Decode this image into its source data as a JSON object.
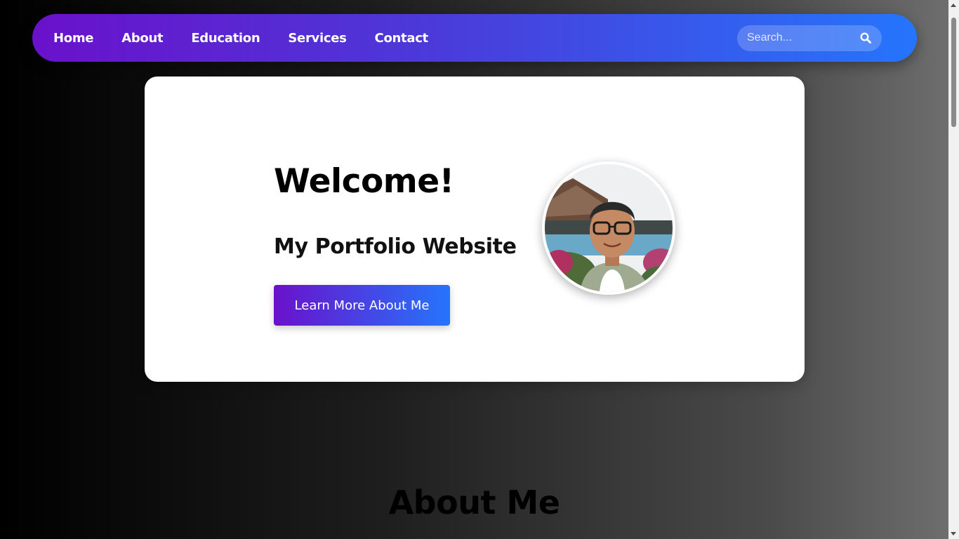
{
  "nav": {
    "links": [
      {
        "label": "Home"
      },
      {
        "label": "About"
      },
      {
        "label": "Education"
      },
      {
        "label": "Services"
      },
      {
        "label": "Contact"
      }
    ],
    "search": {
      "placeholder": "Search...",
      "icon": "search-icon"
    },
    "colors": {
      "gradient_start": "#6a11cb",
      "gradient_end": "#2575fc"
    }
  },
  "hero": {
    "title": "Welcome!",
    "subtitle": "My Portfolio Website",
    "button_label": "Learn More About Me"
  },
  "about": {
    "heading": "About Me"
  }
}
